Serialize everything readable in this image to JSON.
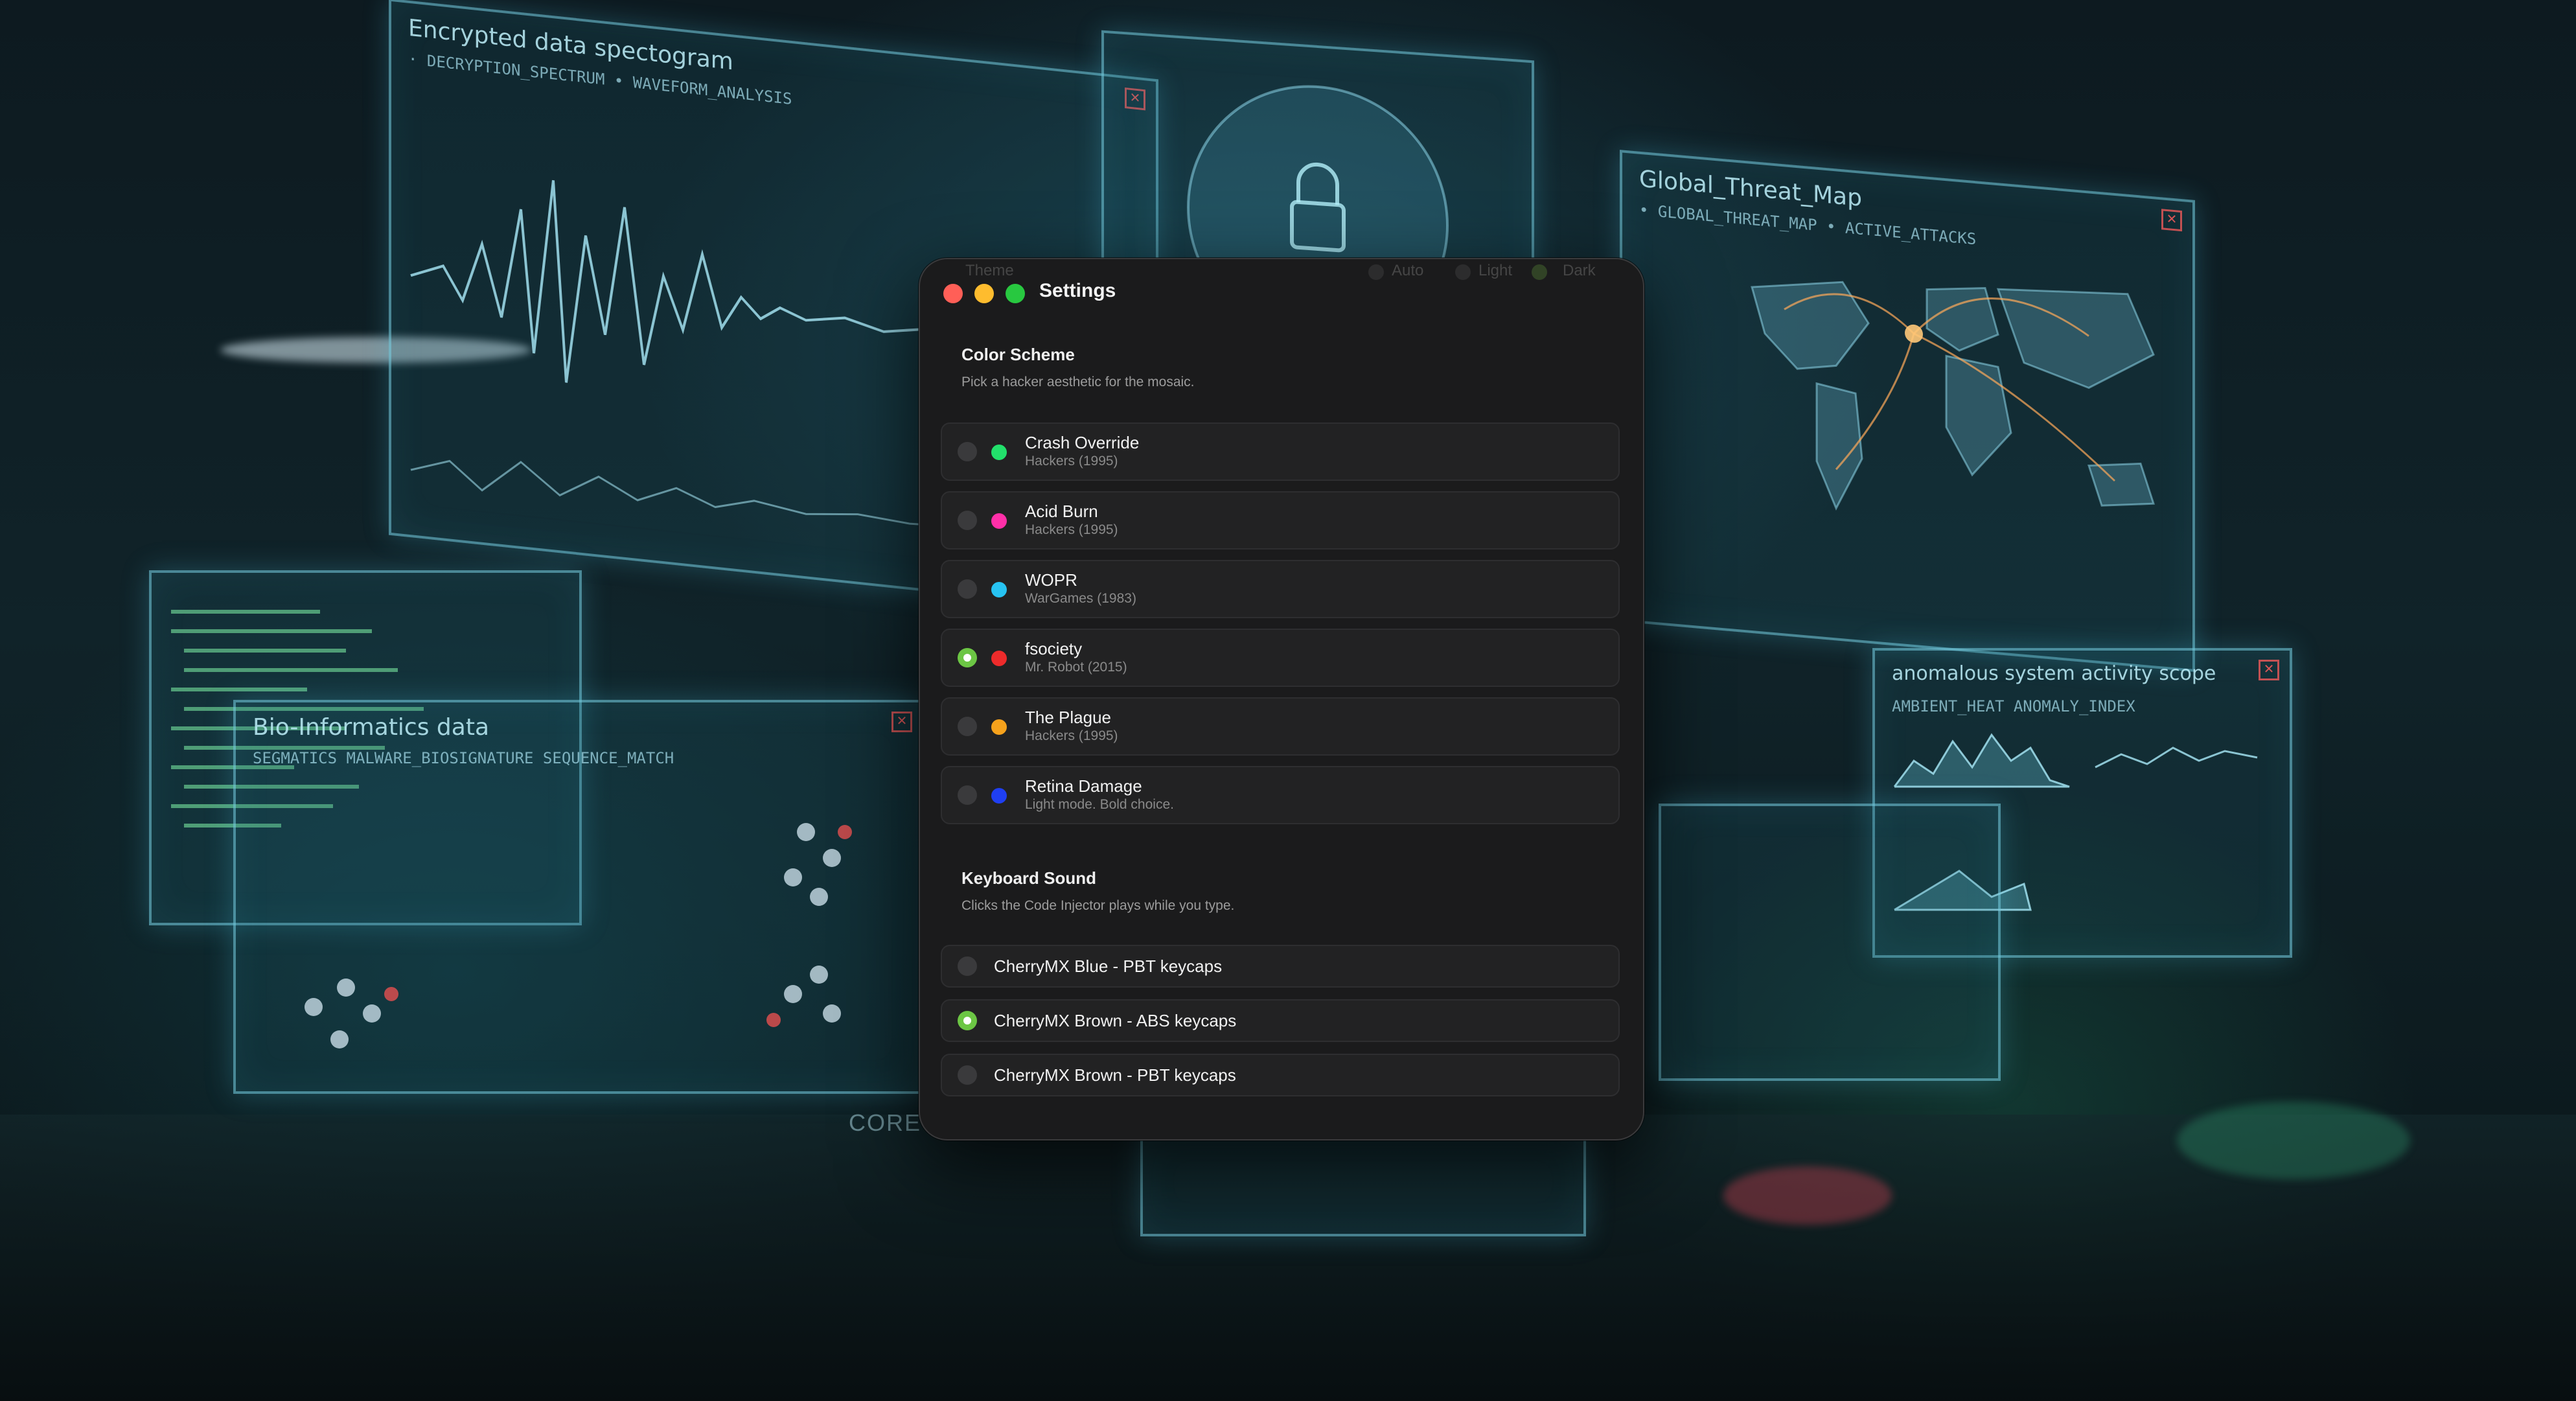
{
  "background": {
    "panels": [
      {
        "title": "Encrypted data spectogram",
        "subtitle": "· DECRYPTION_SPECTRUM • WAVEFORM_ANALYSIS"
      },
      {
        "title": "Bio-Informatics data",
        "subtitle": "SEGMATICS   MALWARE_BIOSIGNATURE   SEQUENCE_MATCH"
      },
      {
        "title": "Global_Threat_Map",
        "subtitle": "• GLOBAL_THREAT_MAP  • ACTIVE_ATTACKS"
      },
      {
        "title": "anomalous system activity scope",
        "subtitle": "AMBIENT_HEAT    ANOMALY_INDEX"
      }
    ],
    "core_label": "CORE"
  },
  "window": {
    "title": "Settings",
    "theme": {
      "label": "Theme",
      "options": [
        "Auto",
        "Light",
        "Dark"
      ],
      "selected": "Dark"
    },
    "color_scheme": {
      "title": "Color Scheme",
      "description": "Pick a hacker aesthetic for the mosaic.",
      "options": [
        {
          "name": "Crash Override",
          "source": "Hackers (1995)",
          "color": "#22e06b",
          "selected": false
        },
        {
          "name": "Acid Burn",
          "source": "Hackers (1995)",
          "color": "#ff2fa8",
          "selected": false
        },
        {
          "name": "WOPR",
          "source": "WarGames (1983)",
          "color": "#27c3f2",
          "selected": false
        },
        {
          "name": "fsociety",
          "source": "Mr. Robot (2015)",
          "color": "#ee2b2b",
          "selected": true
        },
        {
          "name": "The Plague",
          "source": "Hackers (1995)",
          "color": "#f6a21c",
          "selected": false
        },
        {
          "name": "Retina Damage",
          "source": "Light mode. Bold choice.",
          "color": "#1f3ff2",
          "selected": false
        }
      ]
    },
    "keyboard_sound": {
      "title": "Keyboard Sound",
      "description": "Clicks the Code Injector plays while you type.",
      "options": [
        {
          "name": "CherryMX Blue - PBT keycaps",
          "selected": false
        },
        {
          "name": "CherryMX Brown - ABS keycaps",
          "selected": true
        },
        {
          "name": "CherryMX Brown - PBT keycaps",
          "selected": false
        }
      ]
    }
  }
}
